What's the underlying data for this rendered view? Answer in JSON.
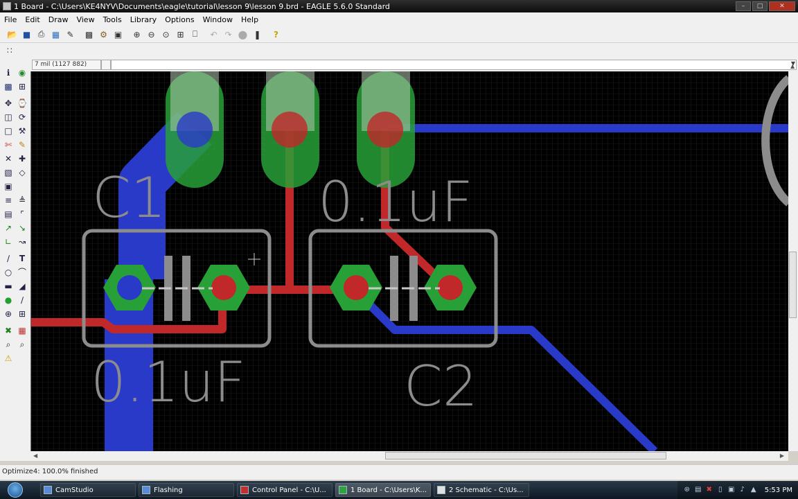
{
  "window": {
    "title": "1 Board - C:\\Users\\KE4NYV\\Documents\\eagle\\tutorial\\lesson 9\\lesson 9.brd - EAGLE 5.6.0 Standard"
  },
  "menu": [
    "File",
    "Edit",
    "Draw",
    "View",
    "Tools",
    "Library",
    "Options",
    "Window",
    "Help"
  ],
  "toolbar": {
    "icons": [
      "open-icon",
      "save-icon",
      "print-icon",
      "cam-icon",
      "script-icon",
      "layer-icon",
      "ulp-icon",
      "zoom-fit-icon",
      "zoom-in-icon",
      "zoom-out-icon",
      "zoom-redraw-icon",
      "zoom-select-icon",
      "undo-icon",
      "redo-icon",
      "stop-icon",
      "go-icon",
      "help-icon"
    ]
  },
  "command": {
    "coordinates": "7 mil (1127 882)",
    "input": ""
  },
  "board": {
    "labels": {
      "c1_name": "C1",
      "c1_value": "0.1uF",
      "c2_name": "C2",
      "c2_value": "0.1uF"
    },
    "colors": {
      "background": "#000000",
      "top_copper": "#c0282a",
      "bottom_copper": "#2a3ac8",
      "pads": "#28a038",
      "silkscreen": "#8c8c8c"
    }
  },
  "status": {
    "text": "Optimize4: 100.0% finished"
  },
  "taskbar": {
    "tasks": [
      {
        "label": "CamStudio",
        "active": false
      },
      {
        "label": "Flashing",
        "active": false
      },
      {
        "label": "Control Panel - C:\\U...",
        "active": false
      },
      {
        "label": "1 Board - C:\\Users\\K...",
        "active": true
      },
      {
        "label": "2 Schematic - C:\\Us...",
        "active": false
      }
    ],
    "clock": "5:53 PM"
  }
}
